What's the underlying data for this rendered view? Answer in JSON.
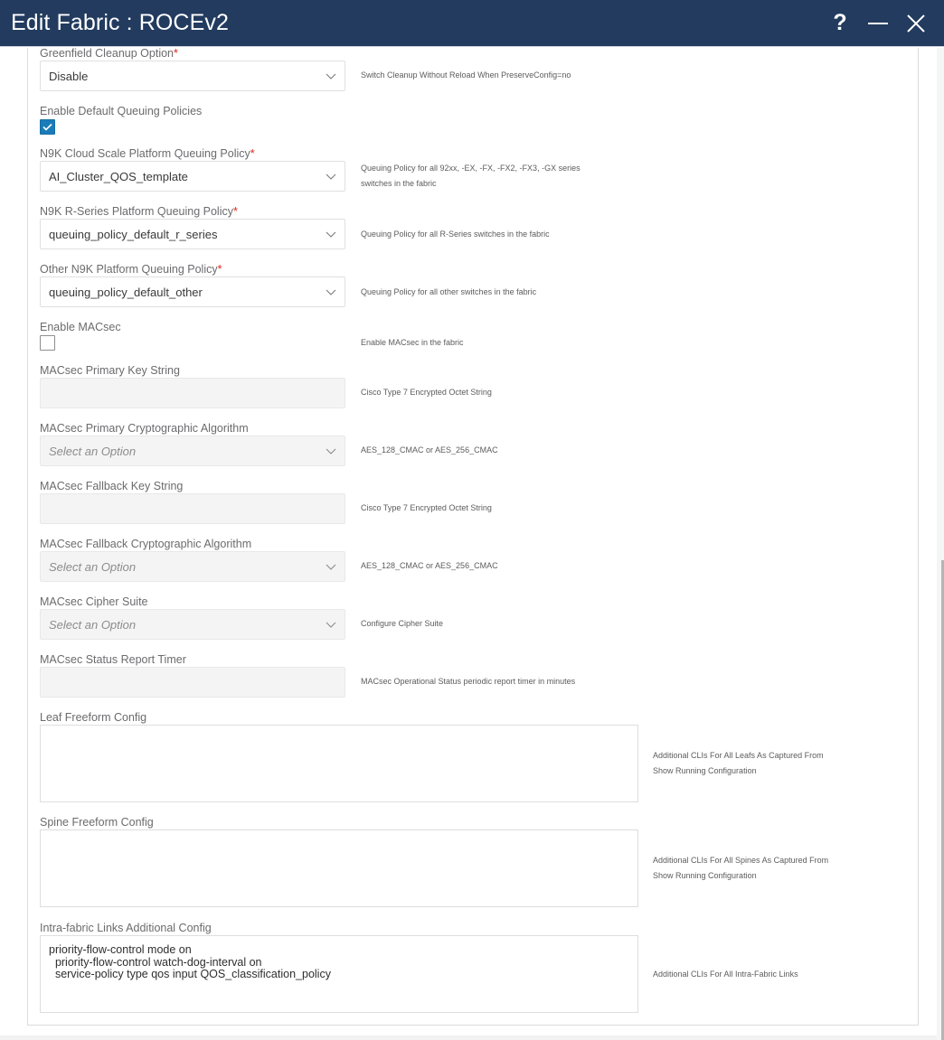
{
  "window": {
    "title": "Edit Fabric : ROCEv2",
    "help_icon": "question-mark-icon",
    "help_glyph": "?",
    "minimize_icon": "minimize-icon",
    "close_icon": "close-icon"
  },
  "colors": {
    "titlebar": "#223b5f",
    "checkbox_checked": "#1a7cb8",
    "required_marker": "#e2231a"
  },
  "fields": {
    "greenfield": {
      "label": "Greenfield Cleanup Option",
      "required": "*",
      "value": "Disable",
      "help": "Switch Cleanup Without Reload When PreserveConfig=no"
    },
    "enable_default_queuing": {
      "label": "Enable Default Queuing Policies",
      "checked": true
    },
    "cloud_scale_policy": {
      "label": "N9K Cloud Scale Platform Queuing Policy",
      "required": "*",
      "value": "AI_Cluster_QOS_template",
      "help_line1": "Queuing Policy for all 92xx, -EX, -FX, -FX2, -FX3, -GX series",
      "help_line2": "switches in the fabric"
    },
    "r_series_policy": {
      "label": "N9K R-Series Platform Queuing Policy",
      "required": "*",
      "value": "queuing_policy_default_r_series",
      "help": "Queuing Policy for all R-Series switches in the fabric"
    },
    "other_policy": {
      "label": "Other N9K Platform Queuing Policy",
      "required": "*",
      "value": "queuing_policy_default_other",
      "help": "Queuing Policy for all other switches in the fabric"
    },
    "enable_macsec": {
      "label": "Enable MACsec",
      "checked": false,
      "help": "Enable MACsec in the fabric"
    },
    "macsec_primary_key": {
      "label": "MACsec Primary Key String",
      "value": "",
      "help": "Cisco Type 7 Encrypted Octet String"
    },
    "macsec_primary_algo": {
      "label": "MACsec Primary Cryptographic Algorithm",
      "placeholder": "Select an Option",
      "help": "AES_128_CMAC or AES_256_CMAC"
    },
    "macsec_fallback_key": {
      "label": "MACsec Fallback Key String",
      "value": "",
      "help": "Cisco Type 7 Encrypted Octet String"
    },
    "macsec_fallback_algo": {
      "label": "MACsec Fallback Cryptographic Algorithm",
      "placeholder": "Select an Option",
      "help": "AES_128_CMAC or AES_256_CMAC"
    },
    "macsec_cipher_suite": {
      "label": "MACsec Cipher Suite",
      "placeholder": "Select an Option",
      "help": "Configure Cipher Suite"
    },
    "macsec_status_timer": {
      "label": "MACsec Status Report Timer",
      "value": "",
      "help": "MACsec Operational Status periodic report timer in minutes"
    },
    "leaf_freeform": {
      "label": "Leaf Freeform Config",
      "value": "",
      "help_line1": "Additional CLIs For All Leafs As Captured From",
      "help_line2": "Show Running Configuration"
    },
    "spine_freeform": {
      "label": "Spine Freeform Config",
      "value": "",
      "help_line1": "Additional CLIs For All Spines As Captured From",
      "help_line2": "Show Running Configuration"
    },
    "intra_fabric": {
      "label": "Intra-fabric Links Additional Config",
      "value": "priority-flow-control mode on\n  priority-flow-control watch-dog-interval on\n  service-policy type qos input QOS_classification_policy",
      "help": "Additional CLIs For All Intra-Fabric Links"
    }
  }
}
